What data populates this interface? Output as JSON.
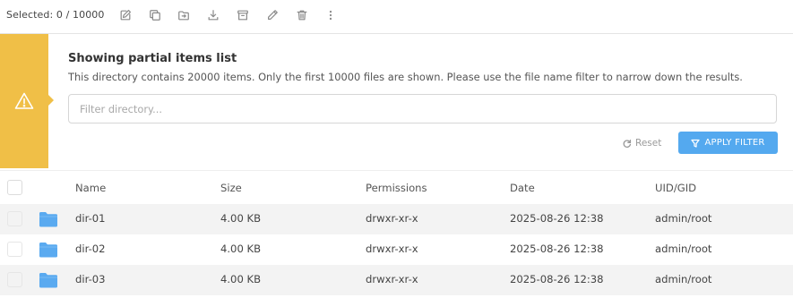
{
  "toolbar": {
    "selected_label": "Selected:",
    "selected_count": "0 / 10000",
    "icons": [
      "edit-icon",
      "copy-icon",
      "move-icon",
      "download-icon",
      "archive-icon",
      "rename-icon",
      "delete-icon",
      "more-icon"
    ]
  },
  "notice": {
    "title": "Showing partial items list",
    "text": "This directory contains 20000 items. Only the first 10000 files are shown. Please use the file name filter to narrow down the results.",
    "filter_placeholder": "Filter directory...",
    "filter_value": "",
    "reset_label": "Reset",
    "apply_label": "APPLY FILTER",
    "accent_color": "#f0bf47",
    "button_color": "#54a9ef"
  },
  "table": {
    "columns": [
      "Name",
      "Size",
      "Permissions",
      "Date",
      "UID/GID"
    ],
    "rows": [
      {
        "name": "dir-01",
        "size": "4.00 KB",
        "permissions": "drwxr-xr-x",
        "date": "2025-08-26 12:38",
        "uid_gid": "admin/root"
      },
      {
        "name": "dir-02",
        "size": "4.00 KB",
        "permissions": "drwxr-xr-x",
        "date": "2025-08-26 12:38",
        "uid_gid": "admin/root"
      },
      {
        "name": "dir-03",
        "size": "4.00 KB",
        "permissions": "drwxr-xr-x",
        "date": "2025-08-26 12:38",
        "uid_gid": "admin/root"
      }
    ],
    "folder_color": "#5aaaf0"
  }
}
